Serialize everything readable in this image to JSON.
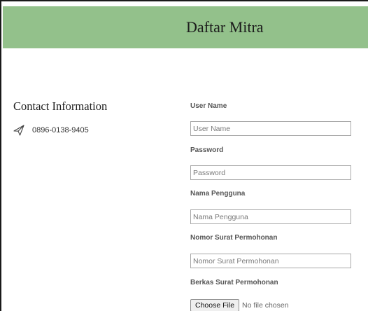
{
  "header": {
    "title": "Daftar Mitra"
  },
  "contact": {
    "title": "Contact Information",
    "phone": "0896-0138-9405",
    "phone_icon": "send-paper-plane-icon"
  },
  "form": {
    "fields": [
      {
        "label": "User Name",
        "placeholder": "User Name",
        "value": ""
      },
      {
        "label": "Password",
        "placeholder": "Password",
        "value": ""
      },
      {
        "label": "Nama Pengguna",
        "placeholder": "Nama Pengguna",
        "value": ""
      },
      {
        "label": "Nomor Surat Permohonan",
        "placeholder": "Nomor Surat Permohonan",
        "value": ""
      }
    ],
    "file": {
      "label": "Berkas Surat Permohonan",
      "button_label": "Choose File",
      "status": "No file chosen"
    }
  },
  "colors": {
    "header_background": "#93c18b",
    "input_border": "#a8a8a8",
    "label_text": "#555555"
  }
}
